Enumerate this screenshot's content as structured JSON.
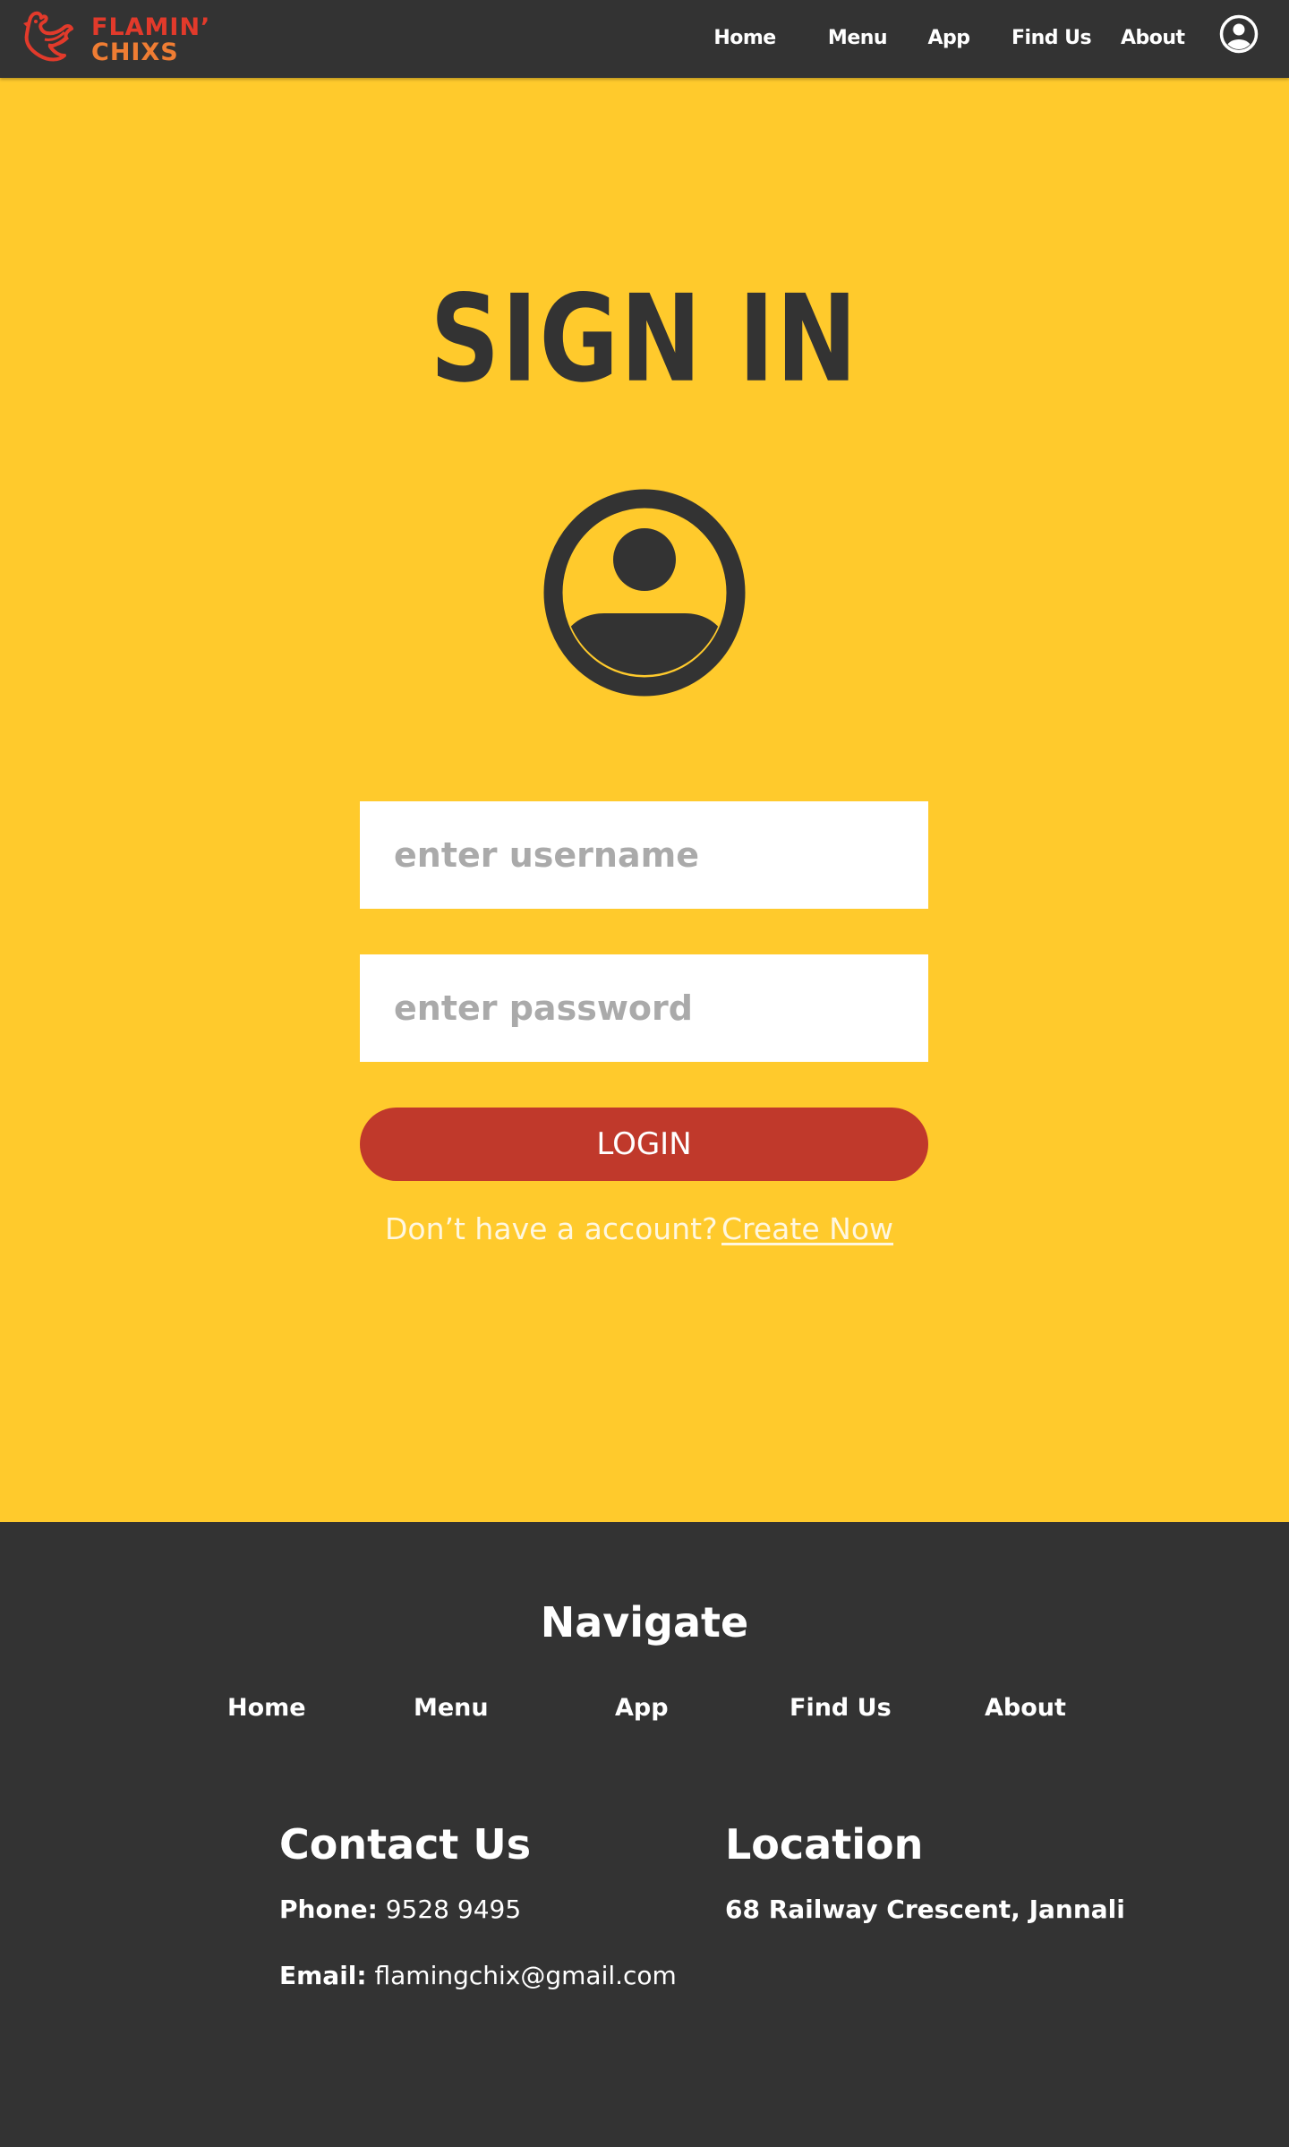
{
  "header": {
    "logo": {
      "line1": "FLAMIN’",
      "line2": "CHIXS"
    },
    "nav": [
      "Home",
      "Menu",
      "App",
      "Find Us",
      "About"
    ],
    "account_icon": "user-circle-icon"
  },
  "signin": {
    "title": "SIGN IN",
    "avatar_icon": "user-circle-icon",
    "username_placeholder": "enter username",
    "password_placeholder": "enter password",
    "login_label": "LOGIN",
    "no_account_text": "Don’t have a account?",
    "create_link": "Create Now"
  },
  "footer": {
    "heading": "Navigate",
    "nav": [
      "Home",
      "Menu",
      "App",
      "Find Us",
      "About"
    ],
    "contact": {
      "title": "Contact Us",
      "phone_label": "Phone:",
      "phone": "9528 9495",
      "email_label": "Email:",
      "email": "flamingchix@gmail.com"
    },
    "location": {
      "title": "Location",
      "address": "68 Railway Crescent, Jannali"
    }
  },
  "colors": {
    "page_background": "#ffca2c",
    "header_footer": "#333333",
    "login_button": "#c0392b",
    "logo_red": "#e23a2b",
    "logo_orange": "#f07d33"
  }
}
